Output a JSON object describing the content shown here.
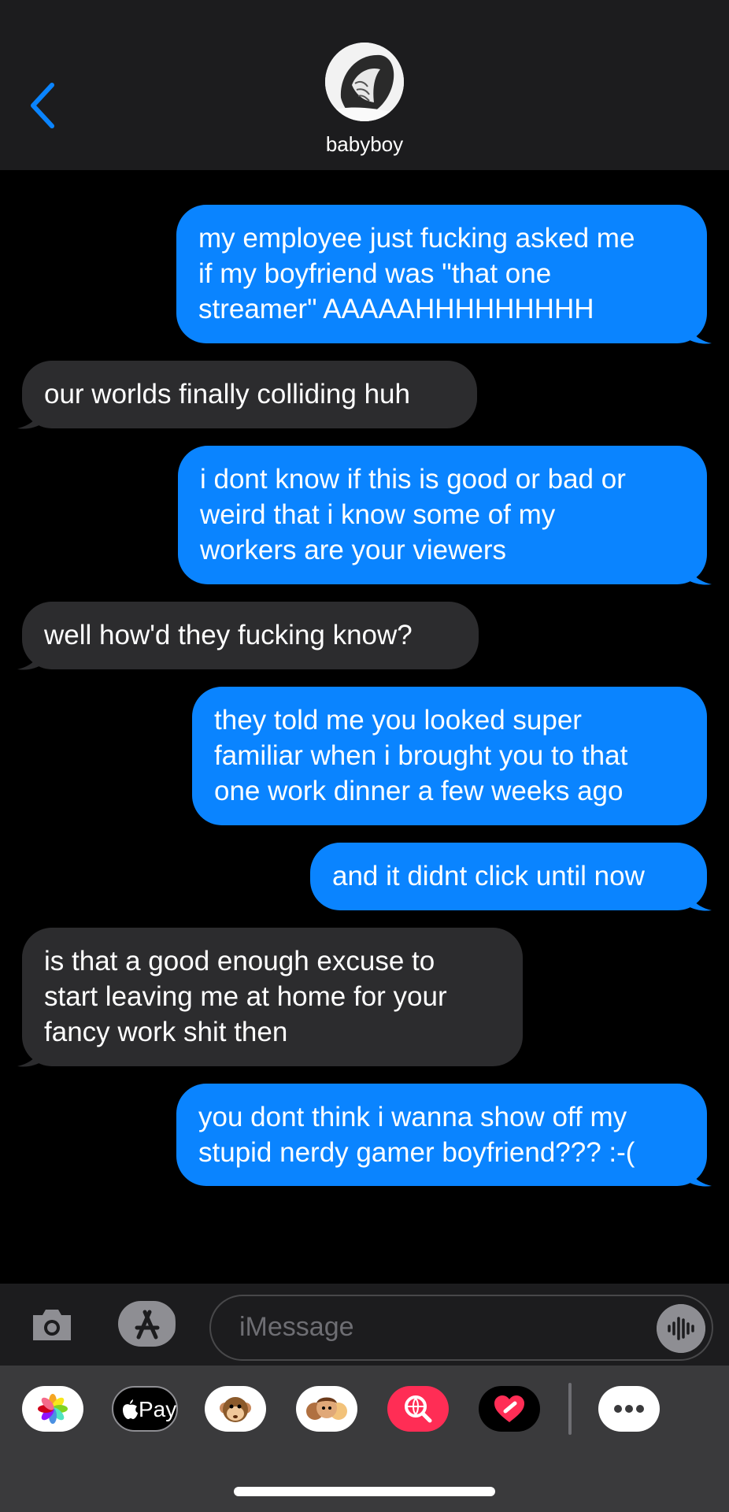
{
  "header": {
    "contact_name": "babyboy"
  },
  "messages": [
    {
      "sender": "me",
      "lines": [
        "my employee just fucking asked me",
        "if my boyfriend was \"that one",
        "streamer\" AAAAAHHHHHHHHH"
      ]
    },
    {
      "sender": "them",
      "lines": [
        "our worlds finally colliding huh"
      ]
    },
    {
      "sender": "me",
      "lines": [
        "i dont know if this is good or bad or",
        "weird that i know some of my",
        "workers are your viewers"
      ]
    },
    {
      "sender": "them",
      "lines": [
        "well how'd they fucking know?"
      ]
    },
    {
      "sender": "me",
      "lines": [
        "they told me you looked super",
        "familiar when i brought you to that",
        "one work dinner a few weeks ago"
      ]
    },
    {
      "sender": "me",
      "lines": [
        "and it didnt click until now"
      ]
    },
    {
      "sender": "them",
      "lines": [
        "is that a good enough excuse to",
        "start leaving me at home for your",
        "fancy work shit then"
      ]
    },
    {
      "sender": "me",
      "lines": [
        "you dont think i wanna show off my",
        "stupid nerdy gamer boyfriend??? :-("
      ]
    }
  ],
  "composer": {
    "placeholder": "iMessage"
  },
  "app_drawer": {
    "apple_pay_label": "Pay",
    "apps": [
      "photos-icon",
      "apple-pay-icon",
      "monkey-memoji-icon",
      "memoji-group-icon",
      "image-search-icon",
      "heart-app-icon",
      "more-apps-icon"
    ]
  },
  "colors": {
    "sent_bubble": "#0a84ff",
    "received_bubble": "#2c2c2e",
    "header_bg": "#1c1c1e",
    "accent": "#0a84ff"
  }
}
